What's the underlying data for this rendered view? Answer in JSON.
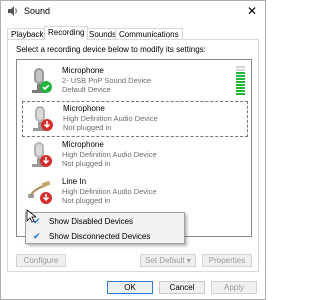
{
  "window": {
    "title": "Sound",
    "close_glyph": "✕"
  },
  "tabs": [
    {
      "label": "Playback",
      "active": false
    },
    {
      "label": "Recording",
      "active": true
    },
    {
      "label": "Sounds",
      "active": false
    },
    {
      "label": "Communications",
      "active": false
    }
  ],
  "instruction": "Select a recording device below to modify its settings:",
  "devices": [
    {
      "name": "Microphone",
      "line1": "2- USB PnP Sound Device",
      "line2": "Default Device",
      "status": "default",
      "icon": "microphone-icon"
    },
    {
      "name": "Microphone",
      "line1": "High Definition Audio Device",
      "line2": "Not plugged in",
      "status": "unplugged",
      "icon": "microphone-icon"
    },
    {
      "name": "Microphone",
      "line1": "High Definition Audio Device",
      "line2": "Not plugged in",
      "status": "unplugged",
      "icon": "microphone-icon"
    },
    {
      "name": "Line In",
      "line1": "High Definition Audio Device",
      "line2": "Not plugged in",
      "status": "unplugged",
      "icon": "line-in-cable-icon"
    }
  ],
  "context_menu": [
    {
      "label": "Show Disabled Devices",
      "checked": true
    },
    {
      "label": "Show Disconnected Devices",
      "checked": true
    }
  ],
  "buttons": {
    "configure": "Configure",
    "set_default": "Set Default",
    "properties": "Properties",
    "ok": "OK",
    "cancel": "Cancel",
    "apply": "Apply"
  },
  "colors": {
    "accent": "#1a6fd6",
    "default_badge": "#1fb53a",
    "unplugged_badge": "#d32f2f",
    "level": "#1fb53a"
  }
}
